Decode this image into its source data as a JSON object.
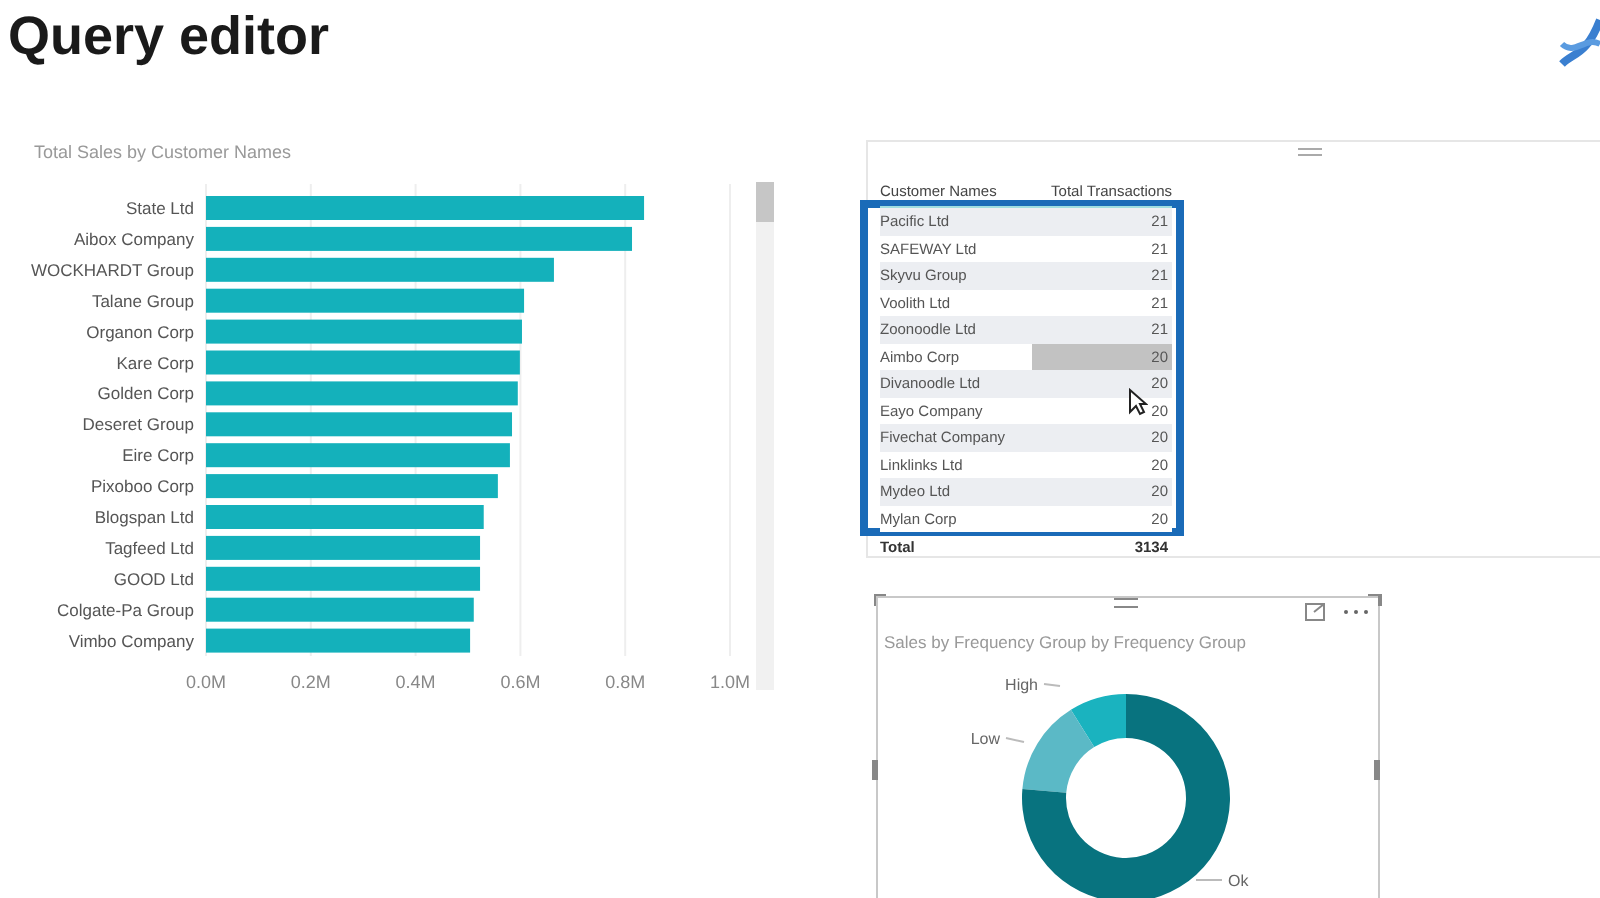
{
  "page_title": "Query editor",
  "bar_visual": {
    "chart_data": {
      "type": "bar",
      "orientation": "horizontal",
      "title": "Total Sales by Customer Names",
      "categories": [
        "State Ltd",
        "Aibox Company",
        "WOCKHARDT Group",
        "Talane Group",
        "Organon Corp",
        "Kare Corp",
        "Golden Corp",
        "Deseret Group",
        "Eire Corp",
        "Pixoboo Corp",
        "Blogspan Ltd",
        "Tagfeed Ltd",
        "GOOD Ltd",
        "Colgate-Pa Group",
        "Vimbo Company"
      ],
      "grid": true,
      "series": [
        {
          "color": "#14b1bb",
          "values": [
            0.836,
            0.813,
            0.664,
            0.607,
            0.603,
            0.599,
            0.595,
            0.584,
            0.58,
            0.557,
            0.53,
            0.523,
            0.523,
            0.511,
            0.504
          ]
        }
      ],
      "xlim": [
        0,
        1.0
      ],
      "xticks": [
        {
          "value": 0,
          "label": "0.0M"
        },
        {
          "value": 0.2,
          "label": "0.2M"
        },
        {
          "value": 0.4,
          "label": "0.4M"
        },
        {
          "value": 0.6,
          "label": "0.6M"
        },
        {
          "value": 0.8,
          "label": "0.8M"
        },
        {
          "value": 1.0,
          "label": "1.0M"
        }
      ]
    }
  },
  "table_visual": {
    "columns": [
      "Customer Names",
      "Total Transactions"
    ],
    "rows": [
      {
        "name": "Pacific Ltd",
        "value": "21",
        "highlighted": false
      },
      {
        "name": "SAFEWAY Ltd",
        "value": "21",
        "highlighted": false
      },
      {
        "name": "Skyvu Group",
        "value": "21",
        "highlighted": false
      },
      {
        "name": "Voolith Ltd",
        "value": "21",
        "highlighted": false
      },
      {
        "name": "Zoonoodle Ltd",
        "value": "21",
        "highlighted": false
      },
      {
        "name": "Aimbo Corp",
        "value": "20",
        "highlighted": true
      },
      {
        "name": "Divanoodle Ltd",
        "value": "20",
        "highlighted": false
      },
      {
        "name": "Eayo Company",
        "value": "20",
        "highlighted": false
      },
      {
        "name": "Fivechat Company",
        "value": "20",
        "highlighted": false
      },
      {
        "name": "Linklinks Ltd",
        "value": "20",
        "highlighted": false
      },
      {
        "name": "Mydeo Ltd",
        "value": "20",
        "highlighted": false
      },
      {
        "name": "Mylan Corp",
        "value": "20",
        "highlighted": false
      }
    ],
    "total": {
      "label": "Total",
      "value": "3134"
    }
  },
  "donut_visual": {
    "title": "Sales by Frequency Group by Frequency Group",
    "selected": true,
    "segments": [
      {
        "label": "High",
        "color": "#1ab3bf"
      },
      {
        "label": "Low",
        "color": "#5bb9c6"
      },
      {
        "label": "Ok",
        "color": "#08737f"
      }
    ]
  }
}
